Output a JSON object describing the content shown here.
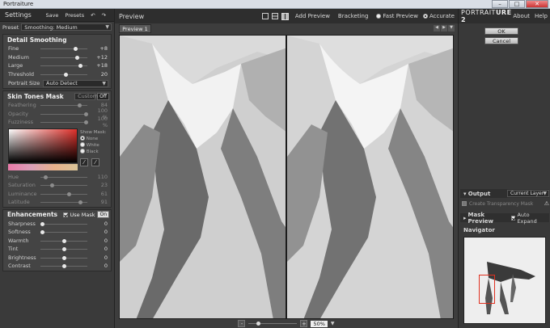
{
  "window": {
    "title": "Portraiture",
    "controls": [
      "–",
      "□",
      "✕"
    ]
  },
  "settings": {
    "title": "Settings",
    "save": "Save",
    "presets": "Presets",
    "undo_icon": "undo-icon",
    "redo_icon": "redo-icon"
  },
  "preset": {
    "label": "Preset",
    "value": "Smoothing: Medium"
  },
  "detail": {
    "title": "Detail Smoothing",
    "rows": [
      {
        "label": "Fine",
        "value": "+8",
        "pos": 0.75
      },
      {
        "label": "Medium",
        "value": "+12",
        "pos": 0.78
      },
      {
        "label": "Large",
        "value": "+18",
        "pos": 0.86
      },
      {
        "label": "Threshold",
        "value": "20",
        "pos": 0.55
      }
    ],
    "size_label": "Portrait Size",
    "size_value": "Auto Detect"
  },
  "skin": {
    "title": "Skin Tones Mask",
    "mode": "Custom",
    "toggle": "Off",
    "rows": [
      {
        "label": "Feathering",
        "value": "84",
        "pos": 0.84
      },
      {
        "label": "Opacity",
        "value": "100 %",
        "pos": 0.98
      },
      {
        "label": "Fuzziness",
        "value": "100 %",
        "pos": 0.98
      }
    ],
    "show_mask": "Show Mask:",
    "mask_opts": [
      "None",
      "White",
      "Black"
    ],
    "hsl": [
      {
        "label": "Hue",
        "value": "110",
        "pos": 0.12
      },
      {
        "label": "Saturation",
        "value": "23",
        "pos": 0.25
      },
      {
        "label": "Luminance",
        "value": "61",
        "pos": 0.62
      },
      {
        "label": "Latitude",
        "value": "91",
        "pos": 0.86
      }
    ]
  },
  "enh": {
    "title": "Enhancements",
    "use_mask": "Use Mask",
    "toggle": "On",
    "rows": [
      {
        "label": "Sharpness",
        "value": "0",
        "pos": 0.05
      },
      {
        "label": "Softness",
        "value": "0",
        "pos": 0.05
      },
      {
        "label": "Warmth",
        "value": "0",
        "pos": 0.5
      },
      {
        "label": "Tint",
        "value": "0",
        "pos": 0.5
      },
      {
        "label": "Brightness",
        "value": "0",
        "pos": 0.5
      },
      {
        "label": "Contrast",
        "value": "0",
        "pos": 0.5
      }
    ]
  },
  "preview": {
    "title": "Preview",
    "add": "Add Preview",
    "bracket": "Bracketing",
    "fast": "Fast Preview",
    "accurate": "Accurate",
    "tab": "Preview 1",
    "zoom": "50%",
    "minus": "-",
    "plus": "+"
  },
  "right": {
    "logo_a": "PORTRAIT",
    "logo_b": "URE 2",
    "about": "About",
    "help": "Help",
    "ok": "OK",
    "cancel": "Cancel",
    "output": "Output",
    "output_value": "Current Layer",
    "transparency": "Create Transparency Mask",
    "mask_preview": "Mask Preview",
    "auto_expand": "Auto Expand",
    "navigator": "Navigator"
  }
}
